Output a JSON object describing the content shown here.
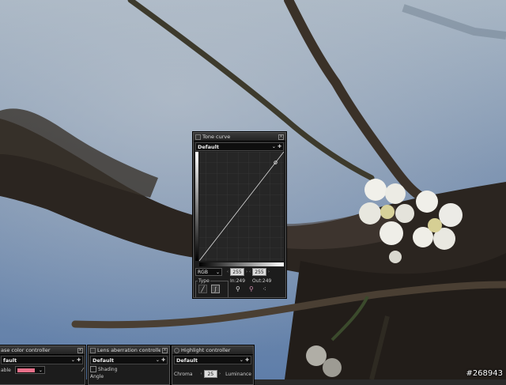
{
  "tone_curve": {
    "title": "Tone curve",
    "preset": "Default",
    "channel": "RGB",
    "in_low": "255",
    "in_high": "255",
    "type_label": "Type",
    "in_readout": "In:249",
    "out_readout": "Out:249",
    "control_point": {
      "in": 230,
      "out": 230
    }
  },
  "panel_color": {
    "title": "ase color controller",
    "preset": "fault",
    "enable_label": "able",
    "swatch_color": "#e8708a"
  },
  "panel_lens": {
    "title": "Lens aberration controller",
    "preset": "Default",
    "shading_label": "Shading",
    "angle_label": "Angle"
  },
  "panel_highlight": {
    "title": "Highlight controller",
    "preset": "Default",
    "chroma_label": "Chroma",
    "chroma_value": "25",
    "luminance_label": "Luminance"
  },
  "watermark": "#268943",
  "colors": {
    "sky_top": "#8fa6c3",
    "sky_bottom": "#6d8cb4",
    "branch": "#2b2520",
    "panel_bg": "#1c1c1c",
    "curve_line": "#dddddd"
  }
}
